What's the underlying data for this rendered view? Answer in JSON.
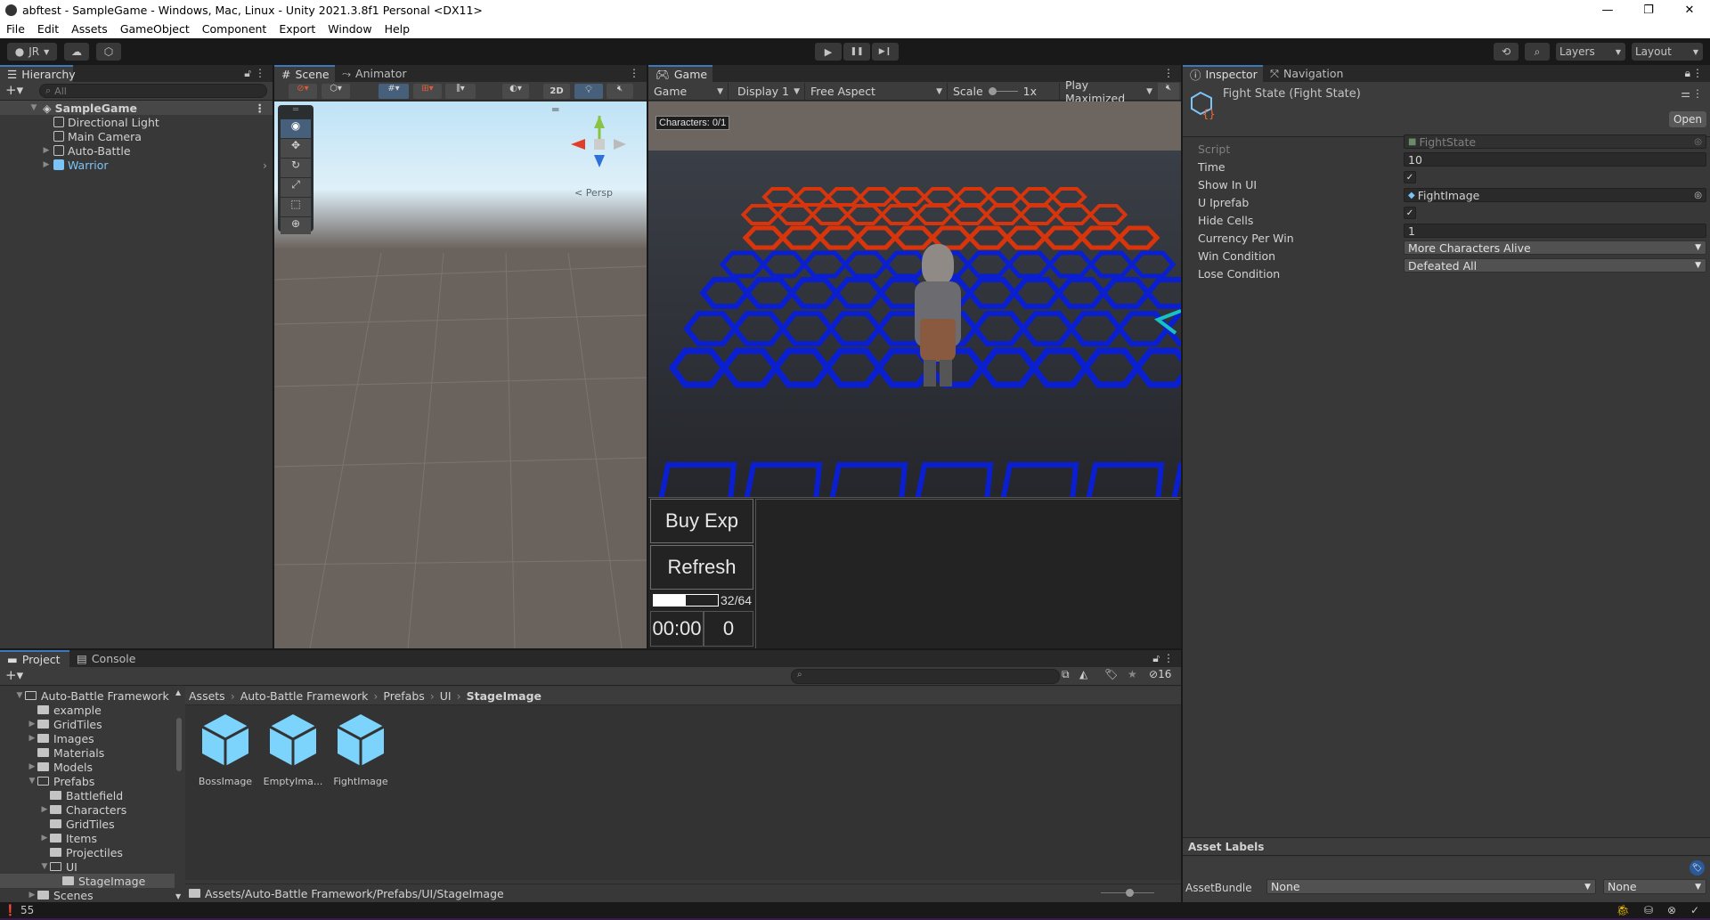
{
  "window": {
    "title": "abftest - SampleGame - Windows, Mac, Linux - Unity 2021.3.8f1 Personal <DX11>",
    "controls": {
      "minimize": "—",
      "maximize": "❐",
      "close": "✕"
    }
  },
  "menu": [
    "File",
    "Edit",
    "Assets",
    "GameObject",
    "Component",
    "Export",
    "Window",
    "Help"
  ],
  "toolbar": {
    "account": "JR",
    "play_controls": {
      "play": "▶",
      "pause": "❚❚",
      "step": "▶❙"
    },
    "layers_label": "Layers",
    "layout_label": "Layout"
  },
  "hierarchy": {
    "tab": "Hierarchy",
    "search_placeholder": "All",
    "scene": "SampleGame",
    "items": [
      {
        "label": "Directional Light",
        "expandable": false
      },
      {
        "label": "Main Camera",
        "expandable": false
      },
      {
        "label": "Auto-Battle",
        "expandable": true
      },
      {
        "label": "Warrior",
        "expandable": true,
        "prefab": true
      }
    ]
  },
  "scene_view": {
    "tabs": [
      "Scene",
      "Animator"
    ],
    "toggle_2d": "2D",
    "persp_label": "< Persp",
    "tools": [
      "view-tool",
      "move-tool",
      "rotate-tool",
      "scale-tool",
      "rect-tool",
      "transform-tool"
    ]
  },
  "game_view": {
    "tab": "Game",
    "mode": "Game",
    "display": "Display 1",
    "aspect": "Free Aspect",
    "scale_label": "Scale",
    "scale_value": "1x",
    "play_mode": "Play Maximized",
    "overlay_label": "Characters: 0/1",
    "ui": {
      "buy_exp": "Buy Exp",
      "refresh": "Refresh",
      "exp_text": "32/64",
      "exp_fraction": 0.5,
      "timer": "00:00",
      "gold": "0"
    }
  },
  "inspector": {
    "tabs": [
      "Inspector",
      "Navigation"
    ],
    "title": "Fight State (Fight State)",
    "open_button": "Open",
    "fields": {
      "script": {
        "label": "Script",
        "value": "FightState"
      },
      "time": {
        "label": "Time",
        "value": "10"
      },
      "show_in_ui": {
        "label": "Show In UI",
        "checked": true
      },
      "ui_prefab": {
        "label": "U Iprefab",
        "value": "FightImage"
      },
      "hide_cells": {
        "label": "Hide Cells",
        "checked": true
      },
      "currency_per_win": {
        "label": "Currency Per Win",
        "value": "1"
      },
      "win_condition": {
        "label": "Win Condition",
        "value": "More Characters Alive"
      },
      "lose_condition": {
        "label": "Lose Condition",
        "value": "Defeated All"
      }
    },
    "asset_labels": "Asset Labels",
    "asset_bundle": {
      "label": "AssetBundle",
      "value": "None",
      "variant": "None"
    }
  },
  "project": {
    "tabs": [
      "Project",
      "Console"
    ],
    "hidden_count": "16",
    "tree": [
      {
        "label": "Auto-Battle Framework",
        "depth": 0,
        "state": "open"
      },
      {
        "label": "example",
        "depth": 1,
        "state": "none"
      },
      {
        "label": "GridTiles",
        "depth": 1,
        "state": "closed"
      },
      {
        "label": "Images",
        "depth": 1,
        "state": "closed"
      },
      {
        "label": "Materials",
        "depth": 1,
        "state": "none"
      },
      {
        "label": "Models",
        "depth": 1,
        "state": "closed"
      },
      {
        "label": "Prefabs",
        "depth": 1,
        "state": "open"
      },
      {
        "label": "Battlefield",
        "depth": 2,
        "state": "none"
      },
      {
        "label": "Characters",
        "depth": 2,
        "state": "closed"
      },
      {
        "label": "GridTiles",
        "depth": 2,
        "state": "none"
      },
      {
        "label": "Items",
        "depth": 2,
        "state": "closed"
      },
      {
        "label": "Projectiles",
        "depth": 2,
        "state": "none"
      },
      {
        "label": "UI",
        "depth": 2,
        "state": "open"
      },
      {
        "label": "StageImage",
        "depth": 3,
        "state": "none",
        "selected": true
      },
      {
        "label": "Scenes",
        "depth": 1,
        "state": "closed"
      }
    ],
    "breadcrumb": [
      "Assets",
      "Auto-Battle Framework",
      "Prefabs",
      "UI",
      "StageImage"
    ],
    "assets": [
      "BossImage",
      "EmptyIma...",
      "FightImage"
    ],
    "path": "Assets/Auto-Battle Framework/Prefabs/UI/StageImage"
  },
  "statusbar": {
    "count": "55"
  },
  "colors": {
    "accent": "#3a79bb",
    "prefab_blue": "#7cc4f8",
    "enemy_hex": "#d8350c",
    "player_hex": "#0a1fd0"
  }
}
